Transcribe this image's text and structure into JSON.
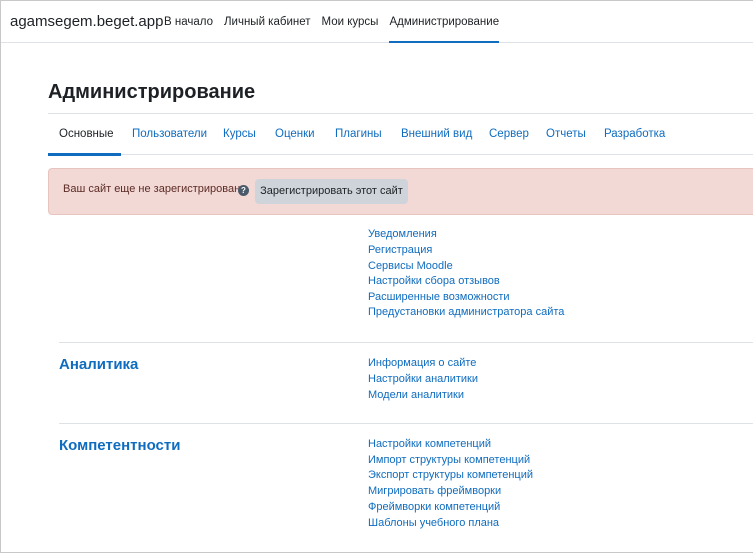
{
  "site": {
    "name": "agamsegem.beget.app"
  },
  "nav": {
    "items": [
      {
        "label": "В начало"
      },
      {
        "label": "Личный кабинет"
      },
      {
        "label": "Мои курсы"
      },
      {
        "label": "Администрирование",
        "active": true
      }
    ]
  },
  "page": {
    "title": "Администрирование"
  },
  "tabs": [
    {
      "label": "Основные",
      "active": true
    },
    {
      "label": "Пользователи"
    },
    {
      "label": "Курсы"
    },
    {
      "label": "Оценки"
    },
    {
      "label": "Плагины"
    },
    {
      "label": "Внешний вид"
    },
    {
      "label": "Сервер"
    },
    {
      "label": "Отчеты"
    },
    {
      "label": "Разработка"
    }
  ],
  "alert": {
    "text": "Ваш сайт еще не зарегистрирован.",
    "help_icon": "question-circle-icon",
    "button": "Зарегистрировать этот сайт"
  },
  "general": {
    "links": [
      "Уведомления",
      "Регистрация",
      "Сервисы Moodle",
      "Настройки сбора отзывов",
      "Расширенные возможности",
      "Предустановки администратора сайта"
    ]
  },
  "analytics": {
    "heading": "Аналитика",
    "links": [
      "Информация о сайте",
      "Настройки аналитики",
      "Модели аналитики"
    ]
  },
  "competencies": {
    "heading": "Компетентности",
    "links": [
      "Настройки компетенций",
      "Импорт структуры компетенций",
      "Экспорт структуры компетенций",
      "Мигрировать фреймворки",
      "Фреймворки компетенций",
      "Шаблоны учебного плана"
    ]
  },
  "colors": {
    "link": "#0f6cbf",
    "alert_bg": "#f2d9d5",
    "button_bg": "#ced4da"
  }
}
